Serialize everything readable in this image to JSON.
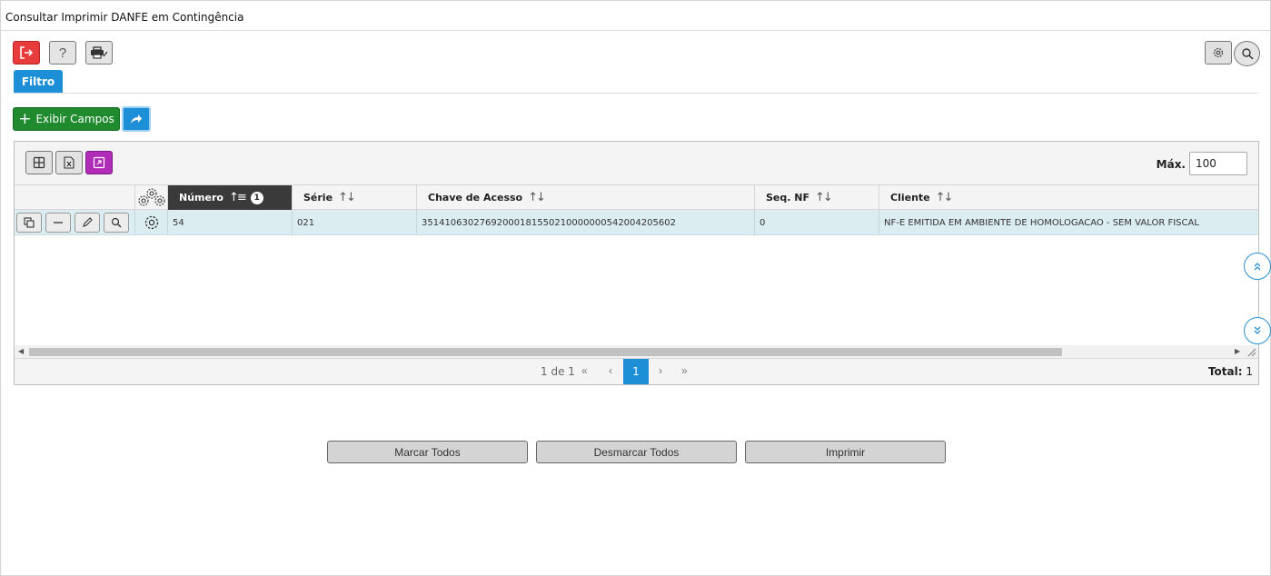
{
  "window": {
    "title": "Consultar Imprimir DANFE em Contingência"
  },
  "toolbar": {
    "exit_icon": "exit-icon",
    "help_label": "?",
    "print_icon": "printer-icon",
    "settings_icon": "gear-icon",
    "search_icon": "search-icon"
  },
  "filter_tab": {
    "label": "Filtro"
  },
  "actions": {
    "exibir_campos_label": "Exibir Campos",
    "share_icon": "share-icon"
  },
  "grid": {
    "toolbar": {
      "max_label": "Máx.",
      "max_value": "100"
    },
    "columns": [
      {
        "key": "numero",
        "label": "Número",
        "sort_badge": "1"
      },
      {
        "key": "serie",
        "label": "Série"
      },
      {
        "key": "chave",
        "label": "Chave de Acesso"
      },
      {
        "key": "seq",
        "label": "Seq. NF"
      },
      {
        "key": "cliente",
        "label": "Cliente"
      }
    ],
    "rows": [
      {
        "numero": "54",
        "serie": "021",
        "chave": "35141063027692000181550210000000542004205602",
        "seq": "0",
        "cliente": "NF-E EMITIDA EM AMBIENTE DE HOMOLOGACAO - SEM VALOR FISCAL"
      }
    ],
    "pager": {
      "page_info": "1 de 1",
      "current_page": "1",
      "total_label": "Total:",
      "total_value": "1"
    }
  },
  "bottom_buttons": {
    "marcar_todos": "Marcar Todos",
    "desmarcar_todos": "Desmarcar Todos",
    "imprimir": "Imprimir"
  },
  "colors": {
    "danger": "#e83b3b",
    "primary": "#1d8fd6",
    "success": "#1f8a2e",
    "purple": "#b02bb8",
    "selected_row": "#dcedf2"
  }
}
